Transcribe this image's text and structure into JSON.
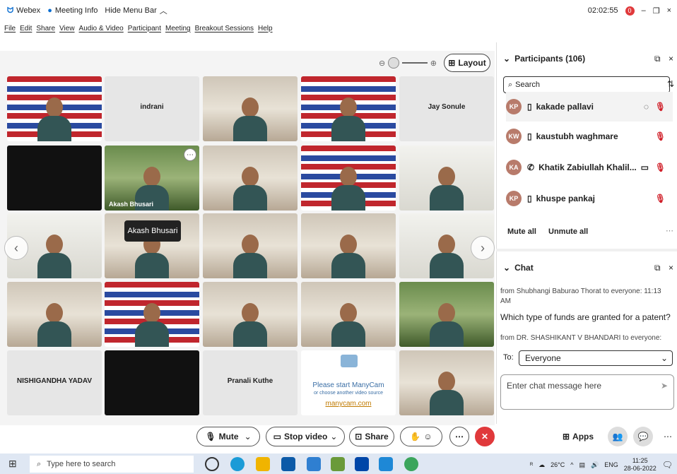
{
  "titlebar": {
    "app": "Webex",
    "meeting_info": "Meeting Info",
    "hide_menu": "Hide Menu Bar",
    "timer": "02:02:55",
    "rec_badge": "0",
    "minimize": "–",
    "restore": "❐",
    "close": "×"
  },
  "menu": [
    "File",
    "Edit",
    "Share",
    "View",
    "Audio & Video",
    "Participant",
    "Meeting",
    "Breakout Sessions",
    "Help"
  ],
  "stage": {
    "layout_label": "Layout",
    "tooltip": "Akash Bhusari",
    "tiles": [
      {
        "name": "",
        "kind": "banner"
      },
      {
        "name": "indrani",
        "kind": "name"
      },
      {
        "name": "",
        "kind": "room"
      },
      {
        "name": "",
        "kind": "banner"
      },
      {
        "name": "Jay Sonule",
        "kind": "name"
      },
      {
        "name": "",
        "kind": "dark"
      },
      {
        "name": "Akash Bhusari",
        "kind": "green"
      },
      {
        "name": "",
        "kind": "room"
      },
      {
        "name": "",
        "kind": "banner"
      },
      {
        "name": "",
        "kind": "white-room"
      },
      {
        "name": "",
        "kind": "white-room"
      },
      {
        "name": "",
        "kind": "room"
      },
      {
        "name": "",
        "kind": "room"
      },
      {
        "name": "",
        "kind": "room"
      },
      {
        "name": "",
        "kind": "white-room"
      },
      {
        "name": "",
        "kind": "room"
      },
      {
        "name": "",
        "kind": "banner"
      },
      {
        "name": "",
        "kind": "room"
      },
      {
        "name": "",
        "kind": "room"
      },
      {
        "name": "",
        "kind": "green"
      },
      {
        "name": "NISHIGANDHA YADAV",
        "kind": "name"
      },
      {
        "name": "",
        "kind": "dark"
      },
      {
        "name": "Pranali Kuthe",
        "kind": "name"
      },
      {
        "name": "",
        "kind": "manycam"
      },
      {
        "name": "",
        "kind": "room"
      }
    ],
    "manycam": {
      "line1": "Please start ManyCam",
      "line2": "or choose another video source",
      "link": "manycam.com"
    }
  },
  "controls": {
    "mute": "Mute",
    "stop_video": "Stop video",
    "share": "Share",
    "apps": "Apps"
  },
  "participants": {
    "title": "Participants (106)",
    "search_placeholder": "Search",
    "rows": [
      {
        "initials": "KP",
        "name": "kakade pallavi"
      },
      {
        "initials": "KW",
        "name": "kaustubh waghmare"
      },
      {
        "initials": "KA",
        "name": "Khatik Zabiullah Khalil..."
      },
      {
        "initials": "KP",
        "name": "khuspe pankaj"
      }
    ],
    "mute_all": "Mute all",
    "unmute_all": "Unmute all"
  },
  "chat": {
    "title": "Chat",
    "msg1_from": "from Shubhangi Baburao Thorat to everyone:",
    "msg1_time": "11:13 AM",
    "msg1_text": "Which type of funds are granted for a patent?",
    "msg2_from": "from DR. SHASHIKANT V BHANDARI to everyone:",
    "to_label": "To:",
    "to_value": "Everyone",
    "input_placeholder": "Enter chat message here"
  },
  "taskbar": {
    "search_placeholder": "Type here to search",
    "weather": "26°C",
    "lang": "ENG",
    "time": "11:25",
    "date": "28-06-2022"
  }
}
